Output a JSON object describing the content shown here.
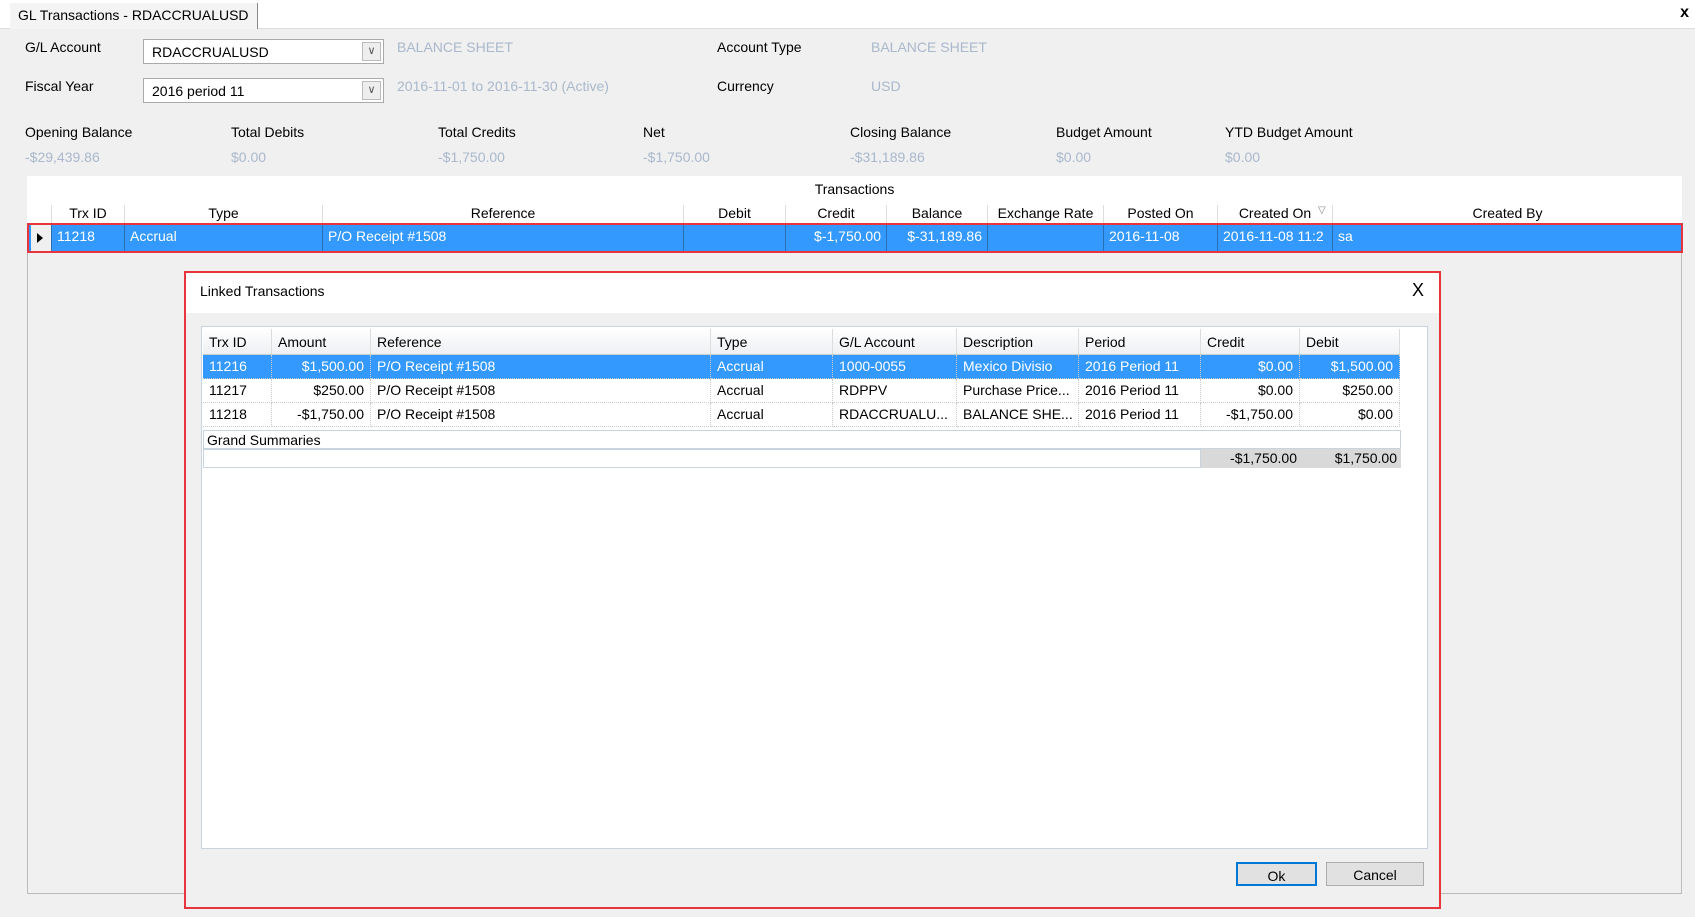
{
  "window": {
    "tab_title": "GL Transactions - RDACCRUALUSD",
    "close_label": "x"
  },
  "filters": {
    "gl_account_label": "G/L Account",
    "gl_account_value": "RDACCRUALUSD",
    "gl_account_desc": "BALANCE SHEET",
    "fiscal_year_label": "Fiscal Year",
    "fiscal_year_value": "2016 period 11",
    "fiscal_year_desc": "2016-11-01 to 2016-11-30 (Active)",
    "account_type_label": "Account Type",
    "account_type_value": "BALANCE SHEET",
    "currency_label": "Currency",
    "currency_value": "USD"
  },
  "summary": [
    {
      "label": "Opening Balance",
      "value": "-$29,439.86"
    },
    {
      "label": "Total Debits",
      "value": "$0.00"
    },
    {
      "label": "Total Credits",
      "value": "-$1,750.00"
    },
    {
      "label": "Net",
      "value": "-$1,750.00"
    },
    {
      "label": "Closing Balance",
      "value": "-$31,189.86"
    },
    {
      "label": "Budget Amount",
      "value": "$0.00"
    },
    {
      "label": "YTD Budget Amount",
      "value": "$0.00"
    }
  ],
  "transactions": {
    "title": "Transactions",
    "columns": [
      "Trx ID",
      "Type",
      "Reference",
      "Debit",
      "Credit",
      "Balance",
      "Exchange Rate",
      "Posted On",
      "Created On",
      "Created By"
    ],
    "rows": [
      [
        "11218",
        "Accrual",
        "P/O Receipt #1508",
        "",
        "$-1,750.00",
        "$-31,189.86",
        "",
        "2016-11-08",
        "2016-11-08 11:2",
        "sa"
      ]
    ]
  },
  "dialog": {
    "title": "Linked Transactions",
    "close_label": "X",
    "columns": [
      "Trx ID",
      "Amount",
      "Reference",
      "Type",
      "G/L Account",
      "Description",
      "Period",
      "Credit",
      "Debit"
    ],
    "rows": [
      [
        "11216",
        "$1,500.00",
        "P/O Receipt #1508",
        "Accrual",
        "1000-0055",
        "Mexico Divisio",
        "2016 Period 11",
        "$0.00",
        "$1,500.00"
      ],
      [
        "11217",
        "$250.00",
        "P/O Receipt #1508",
        "Accrual",
        "RDPPV",
        "Purchase Price...",
        "2016 Period 11",
        "$0.00",
        "$250.00"
      ],
      [
        "11218",
        "-$1,750.00",
        "P/O Receipt #1508",
        "Accrual",
        "RDACCRUALU...",
        "BALANCE SHE...",
        "2016 Period 11",
        "-$1,750.00",
        "$0.00"
      ]
    ],
    "grand_summaries_label": "Grand Summaries",
    "totals": {
      "credit": "-$1,750.00",
      "debit": "$1,750.00"
    },
    "ok_label": "Ok",
    "cancel_label": "Cancel"
  },
  "colors": {
    "selection": "#3399ff",
    "highlight_border": "#e8343c",
    "muted_text": "#a9b8cc"
  }
}
